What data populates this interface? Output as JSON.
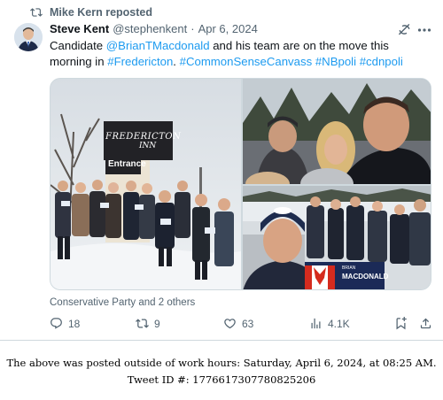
{
  "repost": {
    "text": "Mike Kern reposted",
    "icon": "repost-icon"
  },
  "tweet": {
    "author_name": "Steve Kent",
    "handle": "@stephenkent",
    "separator": "·",
    "date": "Apr 6, 2024",
    "text_parts": [
      {
        "text": "Candidate ",
        "link": false
      },
      {
        "text": "@BrianTMacdonald",
        "link": true
      },
      {
        "text": " and his team are on the move this morning in ",
        "link": false
      },
      {
        "text": "#Fredericton",
        "link": true
      },
      {
        "text": ". ",
        "link": false
      },
      {
        "text": "#CommonSenseCanvass",
        "link": true
      },
      {
        "text": " ",
        "link": false
      },
      {
        "text": "#NBpoli",
        "link": true
      },
      {
        "text": " ",
        "link": false
      },
      {
        "text": "#cdnpoli",
        "link": true
      }
    ],
    "media": {
      "photo1_sign_top": "FREDERICTON",
      "photo1_sign_mid": "INN",
      "photo1_sign_bottom": "Entrance",
      "photo3_sign_small": "BRIAN",
      "photo3_sign_big": "MACDONALD"
    },
    "tagged": "Conservative Party and 2 others",
    "stats": {
      "replies": "18",
      "reposts": "9",
      "likes": "63",
      "views": "4.1K"
    }
  },
  "footer": {
    "line1": "The above was posted outside of work hours: Saturday, April 6, 2024, at 08:25 AM.",
    "line2": "Tweet ID #: 1776617307780825206"
  },
  "colors": {
    "link": "#1d9bf0",
    "muted": "#536471",
    "text": "#0f1419",
    "border": "#cfd9de"
  }
}
